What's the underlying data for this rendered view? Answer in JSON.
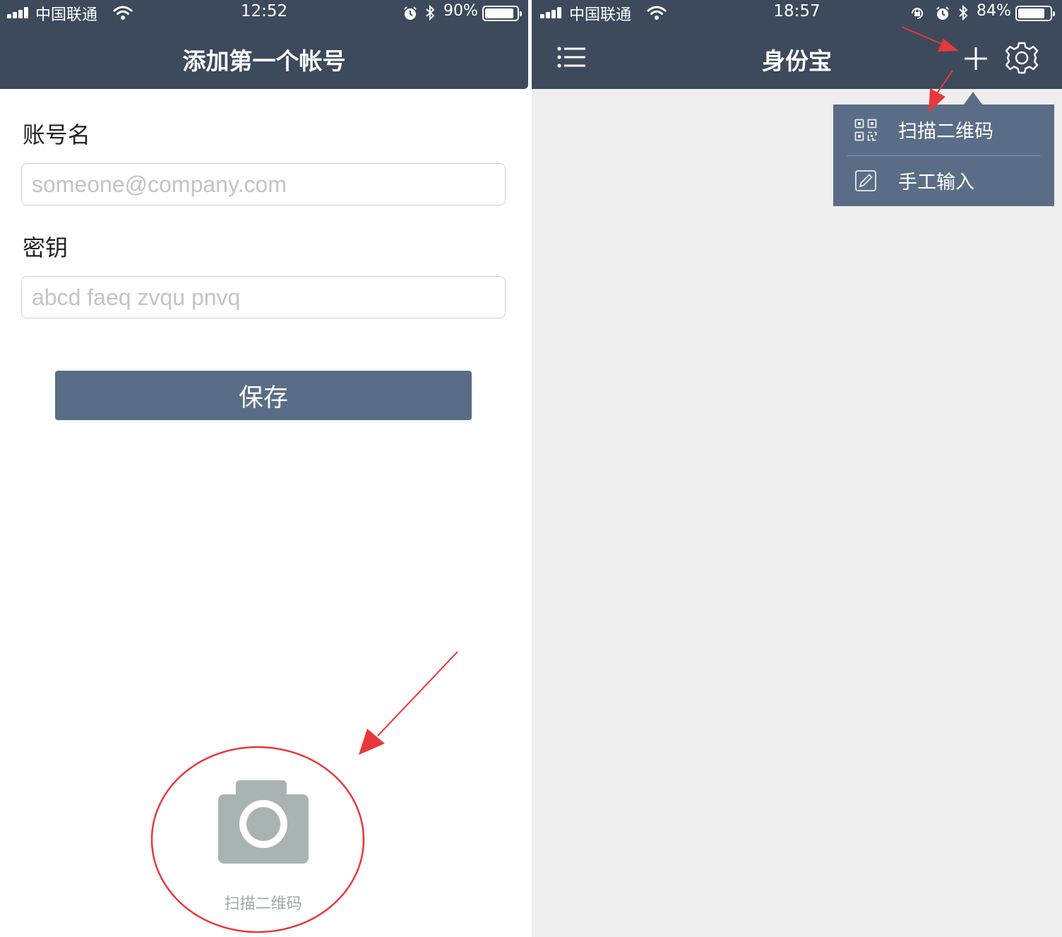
{
  "left_screen": {
    "status_bar": {
      "carrier": "中国联通",
      "time": "12:52",
      "battery": "90%",
      "battery_level": 0.9
    },
    "title": "添加第一个帐号",
    "account_name": {
      "label": "账号名",
      "placeholder": "someone@company.com",
      "value": ""
    },
    "secret_key": {
      "label": "密钥",
      "placeholder": "abcd faeq zvqu pnvq",
      "value": ""
    },
    "save_label": "保存",
    "scan": {
      "icon": "camera-icon",
      "label": "扫描二维码"
    }
  },
  "right_screen": {
    "status_bar": {
      "carrier": "中国联通",
      "time": "18:57",
      "battery": "84%",
      "battery_level": 0.84
    },
    "title": "身份宝",
    "toolbar_icons": [
      "list-icon",
      "plus-icon",
      "gear-icon"
    ],
    "popup_menu": [
      {
        "icon": "qr-code-icon",
        "label": "扫描二维码"
      },
      {
        "icon": "edit-icon",
        "label": "手工输入"
      }
    ]
  },
  "colors": {
    "nav_bar": "#3c4a5c",
    "button": "#5a6d87",
    "popup": "#5b6d86",
    "camera_icon": "#a9b4b2",
    "annotation_red": "#e8383b",
    "background_right": "#efefef"
  }
}
